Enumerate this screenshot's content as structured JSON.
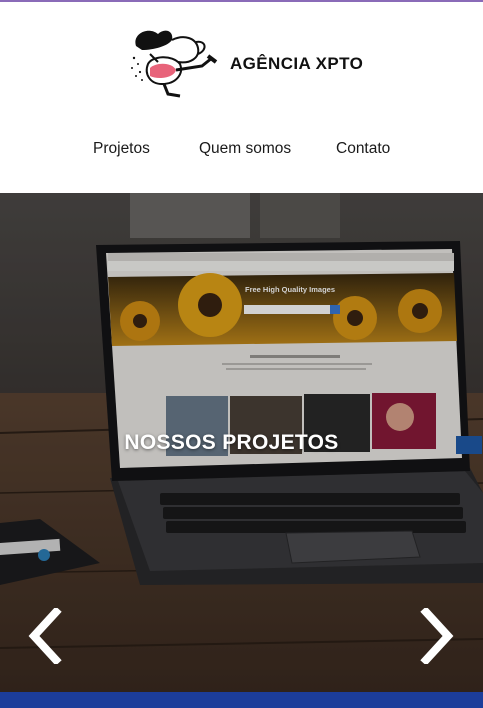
{
  "brand": {
    "name": "AGÊNCIA XPTO",
    "logo_icon": "running-cartoon-character-logo"
  },
  "nav": {
    "items": [
      {
        "label": "Projetos"
      },
      {
        "label": "Quem somos"
      },
      {
        "label": "Contato"
      }
    ]
  },
  "hero": {
    "title": "NOSSOS PROJETOS",
    "prev_icon": "chevron-left-icon",
    "next_icon": "chevron-right-icon",
    "screen": {
      "banner_title": "Free High Quality Images"
    }
  },
  "colors": {
    "top_rule": "#8a6bb8",
    "bottom_bar": "#1c3d9a",
    "hero_text": "#ffffff"
  }
}
